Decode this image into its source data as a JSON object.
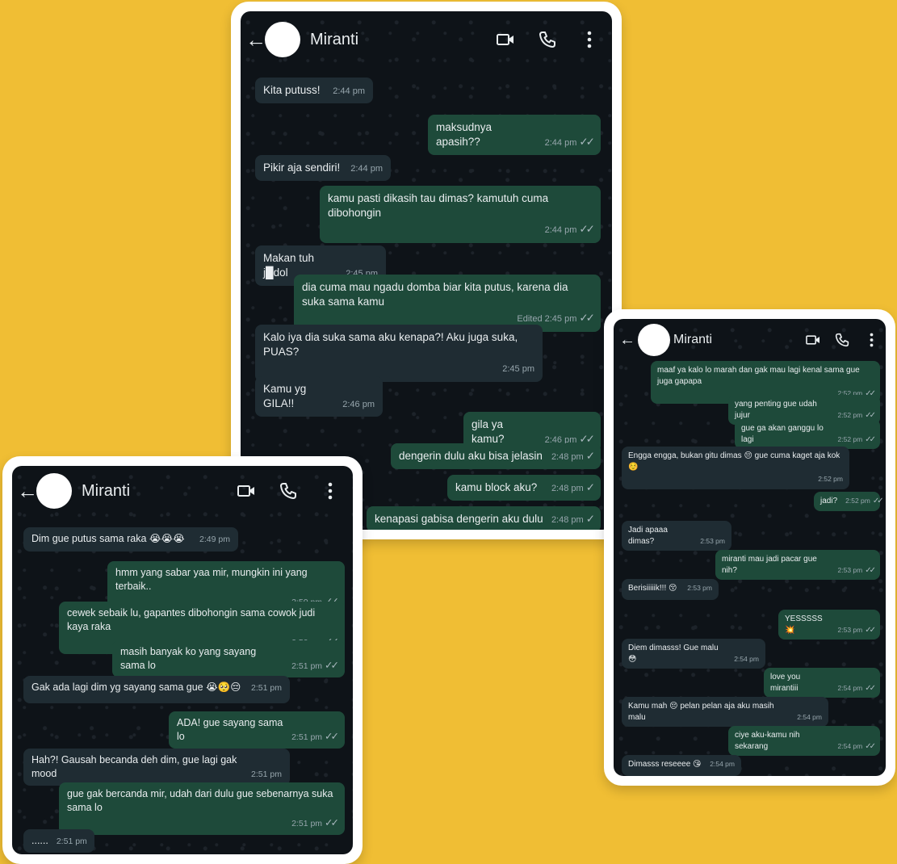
{
  "contact": "Miranti",
  "chat1": [
    {
      "dir": "in",
      "text": "Kita putuss!",
      "time": "2:44 pm"
    },
    {
      "dir": "out",
      "text": "maksudnya apasih??",
      "time": "2:44 pm",
      "status": "read"
    },
    {
      "dir": "in",
      "text": "Pikir aja sendiri!",
      "time": "2:44 pm"
    },
    {
      "dir": "out",
      "text": "kamu pasti dikasih tau dimas? kamutuh cuma dibohongin",
      "time": "2:44 pm",
      "status": "read"
    },
    {
      "dir": "in",
      "text": "Makan tuh j█dol",
      "time": "2:45 pm"
    },
    {
      "dir": "out",
      "text": "dia cuma mau ngadu domba biar kita putus, karena dia suka sama kamu",
      "time": "Edited 2:45 pm",
      "status": "read"
    },
    {
      "dir": "in",
      "text": "Kalo iya dia suka sama aku kenapa?! Aku juga suka, PUAS?",
      "time": "2:45 pm"
    },
    {
      "dir": "in",
      "text": "Kamu yg GILA!!",
      "time": "2:46 pm"
    },
    {
      "dir": "out",
      "text": "gila ya kamu?",
      "time": "2:46 pm",
      "status": "read"
    },
    {
      "dir": "out",
      "text": "dengerin dulu aku bisa jelasin",
      "time": "2:48 pm",
      "status": "sent"
    },
    {
      "dir": "out",
      "text": "kamu block aku?",
      "time": "2:48 pm",
      "status": "sent"
    },
    {
      "dir": "out",
      "text": "kenapasi gabisa dengerin aku dulu",
      "time": "2:48 pm",
      "status": "sent"
    }
  ],
  "chat2": [
    {
      "dir": "in",
      "text": "Dim gue putus sama raka 😭😭😭",
      "time": "2:49 pm"
    },
    {
      "dir": "out",
      "text": "hmm yang sabar yaa mir, mungkin ini yang terbaik..",
      "time": "2:50 pm",
      "status": "read"
    },
    {
      "dir": "out",
      "text": "cewek sebaik lu, gapantes dibohongin sama cowok judi kaya raka",
      "time": "2:50 pm",
      "status": "read"
    },
    {
      "dir": "out",
      "text": "masih banyak ko yang sayang sama lo",
      "time": "2:51 pm",
      "status": "read"
    },
    {
      "dir": "in",
      "text": "Gak ada lagi dim yg sayang sama gue 😭🥺😔",
      "time": "2:51 pm"
    },
    {
      "dir": "out",
      "text": "ADA! gue sayang sama lo",
      "time": "2:51 pm",
      "status": "read"
    },
    {
      "dir": "in",
      "text": "Hah?! Gausah becanda deh dim, gue lagi gak mood",
      "time": "2:51 pm"
    },
    {
      "dir": "out",
      "text": "gue gak bercanda mir, udah dari dulu gue sebenarnya suka sama lo",
      "time": "2:51 pm",
      "status": "read"
    },
    {
      "dir": "in",
      "text": "......",
      "time": "2:51 pm"
    }
  ],
  "chat3": [
    {
      "dir": "out",
      "text": "maaf ya kalo lo marah dan gak mau lagi kenal sama gue juga gapapa",
      "time": "2:52 pm",
      "status": "read"
    },
    {
      "dir": "out",
      "text": "yang penting gue udah jujur",
      "time": "2:52 pm",
      "status": "read"
    },
    {
      "dir": "out",
      "text": "gue ga akan ganggu lo lagi",
      "time": "2:52 pm",
      "status": "read"
    },
    {
      "dir": "in",
      "text": "Engga engga, bukan gitu dimas 😔 gue cuma kaget aja kok ☺️",
      "time": "2:52 pm"
    },
    {
      "dir": "out",
      "text": "jadi?",
      "time": "2:52 pm",
      "status": "read"
    },
    {
      "dir": "in",
      "text": "Jadi apaaa dimas?",
      "time": "2:53 pm"
    },
    {
      "dir": "out",
      "text": "miranti mau jadi pacar gue nih?",
      "time": "2:53 pm",
      "status": "read"
    },
    {
      "dir": "in",
      "text": "Berisiiiiik!!! 😚",
      "time": "2:53 pm"
    },
    {
      "dir": "out",
      "text": "YESSSSS 💥",
      "time": "2:53 pm",
      "status": "read"
    },
    {
      "dir": "in",
      "text": "Diem dimasss! Gue malu 😳",
      "time": "2:54 pm"
    },
    {
      "dir": "out",
      "text": "love you mirantiii",
      "time": "2:54 pm",
      "status": "read"
    },
    {
      "dir": "in",
      "text": "Kamu mah 😔 pelan pelan aja aku masih malu",
      "time": "2:54 pm"
    },
    {
      "dir": "out",
      "text": "ciye aku-kamu nih sekarang",
      "time": "2:54 pm",
      "status": "read"
    },
    {
      "dir": "in",
      "text": "Dimasss reseeee 😘",
      "time": "2:54 pm"
    }
  ],
  "icons": {
    "back": "arrow-left-icon",
    "video": "video-camera-icon",
    "call": "phone-icon",
    "menu": "more-vertical-icon"
  },
  "colors": {
    "background": "#F0BE34",
    "incoming": "#1F2C33",
    "outgoing": "#1E4A3A",
    "chat_bg": "#0E1318"
  }
}
